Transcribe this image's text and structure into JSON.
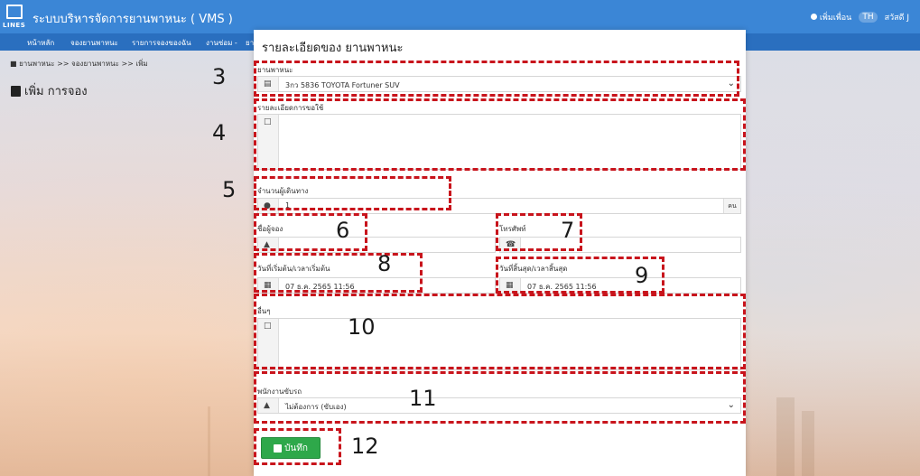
{
  "app": {
    "title": "ระบบบริหารจัดการยานพาหนะ ( VMS )",
    "logo_text": "LINES"
  },
  "topbar": {
    "user_add": "เพิ่มเพื่อน",
    "lang": "TH",
    "greeting": "สวัสดี J"
  },
  "nav": {
    "items": [
      "หน้าหลัก",
      "จองยานพาหนะ",
      "รายการจองของฉัน",
      "งานซ่อม -",
      "ยา"
    ]
  },
  "breadcrumb": "ยานพาหนะ >> จองยานพาหนะ >> เพิ่ม",
  "page": {
    "title": "เพิ่ม การจอง"
  },
  "modal": {
    "title": "รายละเอียดของ ยานพาหนะ",
    "vehicle": {
      "label": "ยานพาหนะ",
      "value": "3กว 5836 TOYOTA Fortuner SUV"
    },
    "details": {
      "label": "รายละเอียดการขอใช้",
      "value": ""
    },
    "passengers": {
      "label": "จำนวนผู้เดินทาง",
      "value": "1",
      "suffix": "คน"
    },
    "booker": {
      "label": "ชื่อผู้จอง",
      "value": ""
    },
    "phone": {
      "label": "โทรศัพท์",
      "value": ""
    },
    "start": {
      "label": "วันที่เริ่มต้น/เวลาเริ่มต้น",
      "value": "07 ธ.ค. 2565 11:56"
    },
    "end": {
      "label": "วันที่สิ้นสุด/เวลาสิ้นสุด",
      "value": "07 ธ.ค. 2565 11:56"
    },
    "other": {
      "label": "อื่นๆ",
      "value": ""
    },
    "driver": {
      "label": "พนักงานขับรถ",
      "value": "ไม่ต้องการ (ขับเอง)"
    },
    "save_label": "บันทึก"
  },
  "annotations": [
    "3",
    "4",
    "5",
    "6",
    "7",
    "8",
    "9",
    "10",
    "11",
    "12"
  ],
  "colors": {
    "topbar": "#3b86d6",
    "navbar": "#2a6fbf",
    "save": "#2ea84a",
    "annotation": "#c8141c"
  }
}
